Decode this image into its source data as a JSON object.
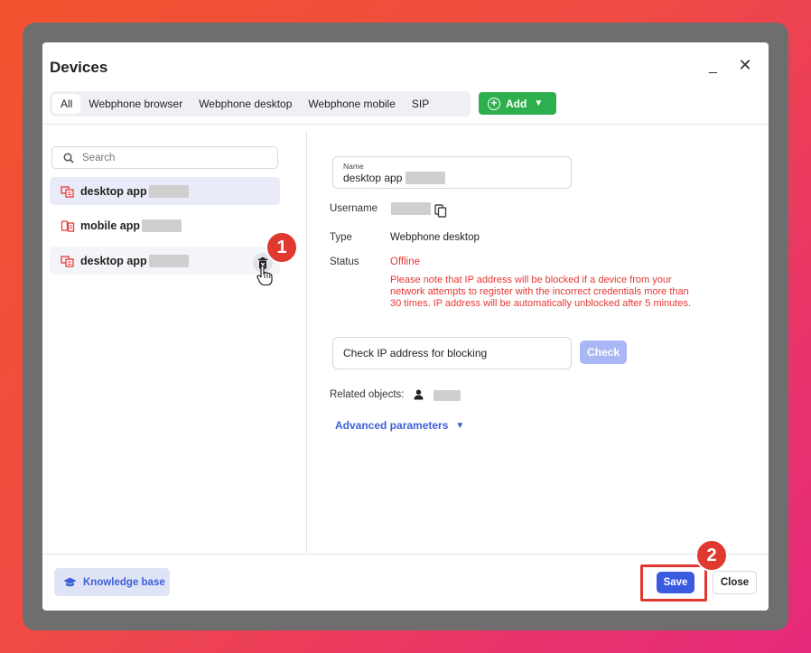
{
  "dialog": {
    "title": "Devices",
    "minimize_glyph": "_",
    "close_glyph": "✕"
  },
  "tabs": [
    {
      "label": "All",
      "active": true
    },
    {
      "label": "Webphone browser",
      "active": false
    },
    {
      "label": "Webphone desktop",
      "active": false
    },
    {
      "label": "Webphone mobile",
      "active": false
    },
    {
      "label": "SIP",
      "active": false
    }
  ],
  "add_button": {
    "label": "Add",
    "icon": "plus-circle-icon"
  },
  "sidebar": {
    "search_placeholder": "Search",
    "devices": [
      {
        "label": "desktop app",
        "icon": "desktop-phone-icon",
        "selected": true
      },
      {
        "label": "mobile app",
        "icon": "mobile-phone-icon",
        "selected": false
      },
      {
        "label": "desktop app",
        "icon": "desktop-phone-icon",
        "selected": false,
        "hovered": true
      }
    ]
  },
  "annotations": {
    "step1": "1",
    "step2": "2"
  },
  "details": {
    "name_label": "Name",
    "name_value": "desktop app",
    "username_label": "Username",
    "type_label": "Type",
    "type_value": "Webphone desktop",
    "status_label": "Status",
    "status_value": "Offline",
    "warning": "Please note that IP address will be blocked if a device from your network attempts to register with the incorrect credentials more than 30 times. IP address will be automatically unblocked after 5 minutes.",
    "ip_check_text": "Check IP address for blocking",
    "check_button": "Check",
    "related_label": "Related objects:",
    "advanced_label": "Advanced parameters"
  },
  "footer": {
    "knowledge_base": "Knowledge base",
    "save": "Save",
    "close": "Close"
  },
  "colors": {
    "accent_blue": "#3a5be0",
    "add_green": "#2eaf4e",
    "status_red": "#e53935",
    "annotation_red": "#e0392f"
  }
}
